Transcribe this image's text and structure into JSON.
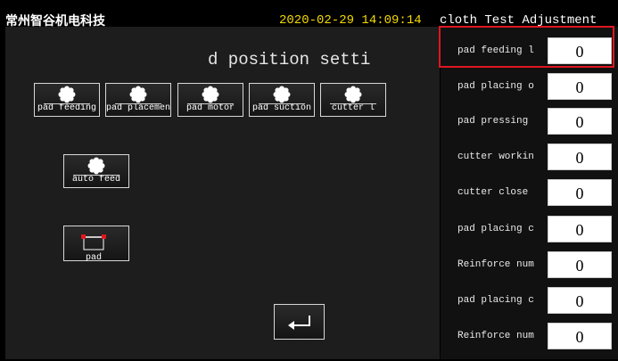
{
  "header": {
    "company": "常州智谷机电科技",
    "datetime": "2020-02-29 14:09:14",
    "title": "cloth Test Adjustment"
  },
  "main": {
    "heading": "d position setti",
    "icon_buttons": [
      {
        "label": "pad feeding",
        "icon": "gear-icon"
      },
      {
        "label": "pad placement",
        "icon": "gear-icon"
      },
      {
        "label": "pad motor",
        "icon": "gear-icon"
      },
      {
        "label": "pad suction",
        "icon": "gear-icon"
      },
      {
        "label": "cutter l",
        "icon": "gear-icon"
      }
    ],
    "auto_feed": {
      "label": "auto feed",
      "icon": "gear-icon"
    },
    "pad_button": {
      "label": "pad",
      "icon": "pad-icon"
    },
    "return_button": {
      "icon": "return-arrow-icon"
    }
  },
  "params": [
    {
      "label": "pad feeding l",
      "value": "0"
    },
    {
      "label": "pad placing o",
      "value": "0"
    },
    {
      "label": "pad pressing",
      "value": "0"
    },
    {
      "label": "cutter workin",
      "value": "0"
    },
    {
      "label": "cutter close",
      "value": "0"
    },
    {
      "label": "pad placing c",
      "value": "0"
    },
    {
      "label": "Reinforce num",
      "value": "0"
    },
    {
      "label": "pad placing c",
      "value": "0"
    },
    {
      "label": "Reinforce num",
      "value": "0"
    }
  ],
  "colors": {
    "datetime": "#f4d900",
    "highlight": "#e0161e",
    "background": "#000000"
  }
}
